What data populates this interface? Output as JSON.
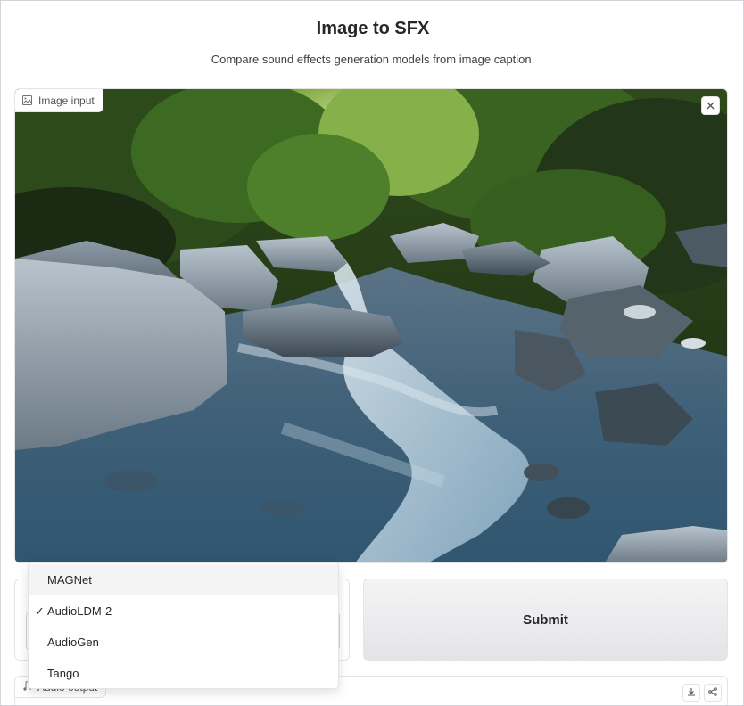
{
  "header": {
    "title": "Image to SFX",
    "subtitle": "Compare sound effects generation models from image caption."
  },
  "image_input": {
    "label": "Image input",
    "label_icon": "image-icon",
    "clear_icon": "close-icon"
  },
  "model_select": {
    "selected": "AudioLDM-2",
    "options": [
      {
        "label": "MAGNet",
        "checked": false
      },
      {
        "label": "AudioLDM-2",
        "checked": true
      },
      {
        "label": "AudioGen",
        "checked": false
      },
      {
        "label": "Tango",
        "checked": false
      }
    ],
    "check_mark": "✓"
  },
  "submit": {
    "label": "Submit"
  },
  "audio_output": {
    "label": "Audio output",
    "label_icon": "music-note-icon",
    "download_icon": "download-icon",
    "share_icon": "share-icon"
  },
  "colors": {
    "accent_border": "#e4e4e7",
    "submit_bg_top": "#f4f4f5",
    "submit_bg_bottom": "#e4e4e7"
  }
}
